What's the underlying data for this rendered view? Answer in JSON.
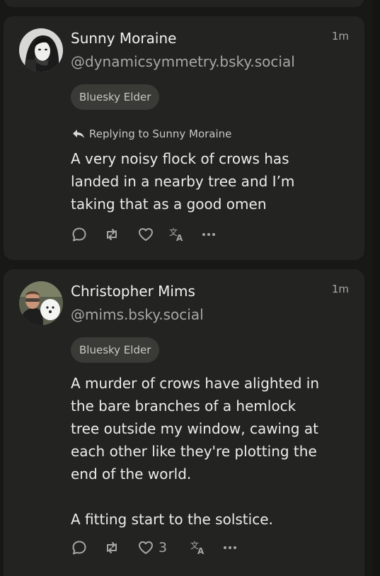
{
  "posts": [
    {
      "author": "Sunny Moraine",
      "handle": "@dynamicsymmetry.bsky.social",
      "time": "1m",
      "badge": "Bluesky Elder",
      "reply_to": "Replying to Sunny Moraine",
      "text": "A very noisy flock of crows has\nlanded in a nearby tree and I’m\ntaking that as a good omen",
      "like_count": ""
    },
    {
      "author": "Christopher Mims",
      "handle": "@mims.bsky.social",
      "time": "1m",
      "badge": "Bluesky Elder",
      "text": "A murder of crows have alighted in\nthe bare branches of a hemlock\ntree outside my window, cawing at\neach other like they're plotting the\nend of the world.\n\nA fitting start to the solstice.",
      "like_count": "3"
    }
  ],
  "icons": {
    "reply": "comment-bubble-icon",
    "repost": "repost-arrows-icon",
    "like": "heart-icon",
    "translate": "translate-icon",
    "more": "ellipsis-icon",
    "reply_arrow": "reply-arrow-icon"
  }
}
